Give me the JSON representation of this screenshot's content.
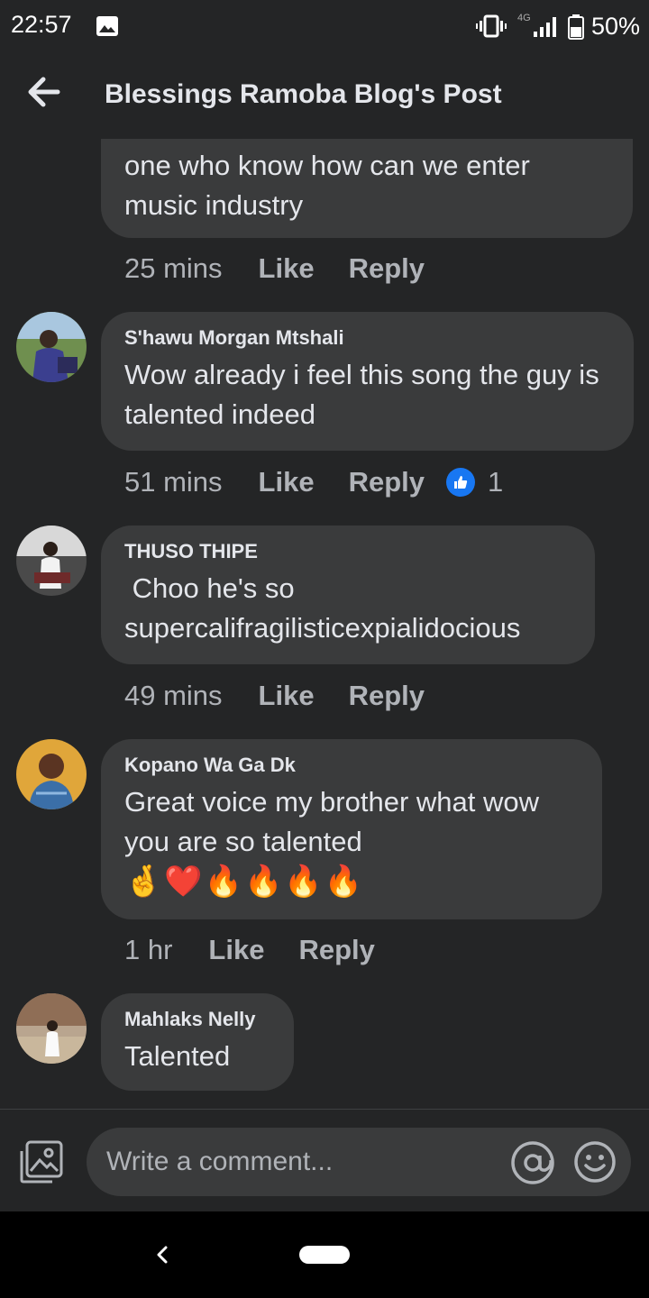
{
  "status": {
    "time": "22:57",
    "network": "4G",
    "battery": "50%",
    "icons": [
      "gallery-icon",
      "vibrate-icon",
      "signal-icon",
      "battery-icon"
    ]
  },
  "header": {
    "title": "Blessings Ramoba Blog's Post",
    "back_icon": "back-arrow-icon"
  },
  "comments": [
    {
      "author": "",
      "text": "one who know how can we enter music industry",
      "time": "25 mins",
      "like": "Like",
      "reply": "Reply"
    },
    {
      "author": "S'hawu Morgan Mtshali",
      "text": "Wow already i feel this song the guy is talented indeed",
      "time": "51 mins",
      "like": "Like",
      "reply": "Reply",
      "reaction_count": "1"
    },
    {
      "author": "THUSO THIPE",
      "text": " Choo he's so supercalifragilisticexpialidocious",
      "time": "49 mins",
      "like": "Like",
      "reply": "Reply"
    },
    {
      "author": "Kopano Wa Ga Dk",
      "text": "Great voice my brother what wow you are so talented",
      "emoji": "🤞❤️🔥🔥🔥🔥",
      "time": "1 hr",
      "like": "Like",
      "reply": "Reply"
    },
    {
      "author": "Mahlaks Nelly",
      "text": "Talented"
    }
  ],
  "composer": {
    "placeholder": "Write a comment..."
  },
  "colors": {
    "background": "#242526",
    "bubble": "#3a3b3c",
    "like_blue": "#1877f2",
    "meta_text": "#b0b3b8"
  }
}
